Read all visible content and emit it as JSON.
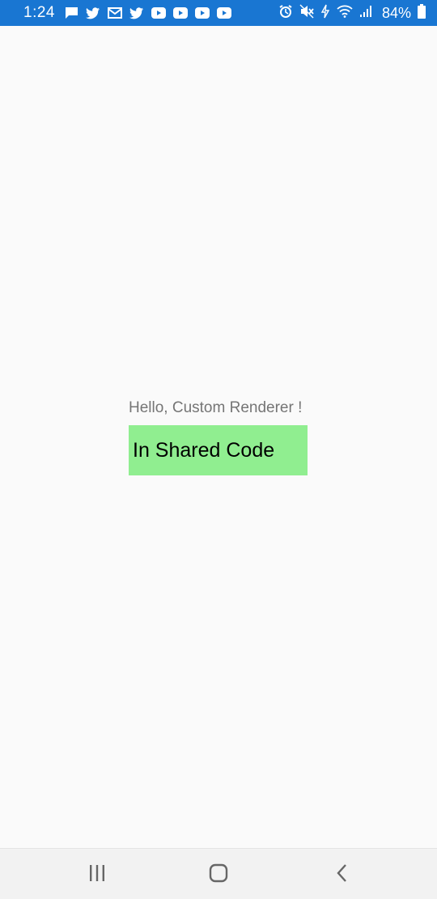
{
  "status_bar": {
    "time": "1:24",
    "battery": "84%",
    "background": "#1976d2",
    "notification_icons": [
      "message-icon",
      "twitter-icon",
      "gmail-icon",
      "twitter-icon",
      "youtube-icon",
      "youtube-icon",
      "youtube-icon",
      "youtube-icon"
    ],
    "system_icons": [
      "alarm-icon",
      "mute-icon",
      "data-saver-icon",
      "wifi-icon",
      "signal-icon",
      "battery-icon"
    ]
  },
  "content": {
    "hello_text": "Hello, Custom Renderer !",
    "shared_code_text": "In Shared Code",
    "shared_code_bg": "#90ee90"
  },
  "nav_bar": {
    "buttons": [
      "recents-icon",
      "home-icon",
      "back-icon"
    ]
  }
}
